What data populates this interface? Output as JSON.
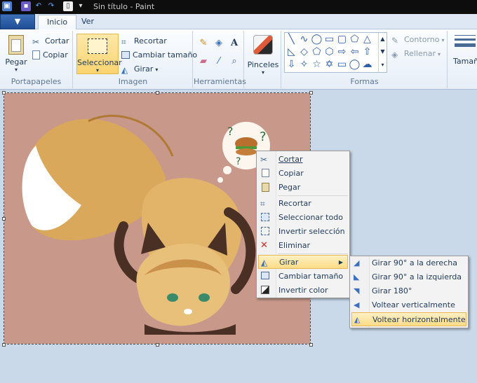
{
  "window": {
    "title": "Sin título - Paint"
  },
  "tabs": {
    "file": "▼",
    "inicio": "Inicio",
    "ver": "Ver"
  },
  "groups": {
    "portapapeles": {
      "label": "Portapapeles",
      "pegar": "Pegar",
      "cortar": "Cortar",
      "copiar": "Copiar"
    },
    "imagen": {
      "label": "Imagen",
      "seleccionar": "Seleccionar",
      "recortar": "Recortar",
      "cambiar_tamano": "Cambiar tamaño",
      "girar": "Girar"
    },
    "herramientas": {
      "label": "Herramientas"
    },
    "pinceles": {
      "label": "Pinceles"
    },
    "formas": {
      "label": "Formas",
      "contorno": "Contorno",
      "rellenar": "Rellenar",
      "tamano": "Tamaño"
    }
  },
  "context_menu": {
    "items": [
      {
        "label": "Cortar",
        "icon": "scissors-icon"
      },
      {
        "label": "Copiar",
        "icon": "copy-icon"
      },
      {
        "label": "Pegar",
        "icon": "paste-icon"
      },
      {
        "label": "Recortar",
        "icon": "crop-icon"
      },
      {
        "label": "Seleccionar todo",
        "icon": "select-all-icon"
      },
      {
        "label": "Invertir selección",
        "icon": "invert-selection-icon"
      },
      {
        "label": "Eliminar",
        "icon": "delete-icon"
      },
      {
        "label": "Girar",
        "icon": "rotate-icon",
        "highlighted": true,
        "submenu": true
      },
      {
        "label": "Cambiar tamaño",
        "icon": "resize-icon"
      },
      {
        "label": "Invertir color",
        "icon": "invert-color-icon"
      }
    ]
  },
  "submenu": {
    "items": [
      {
        "label": "Girar 90° a la derecha",
        "icon": "rotate-right-icon"
      },
      {
        "label": "Girar 90° a la izquierda",
        "icon": "rotate-left-icon"
      },
      {
        "label": "Girar 180°",
        "icon": "rotate-180-icon"
      },
      {
        "label": "Voltear verticalmente",
        "icon": "flip-vertical-icon"
      },
      {
        "label": "Voltear horizontalmente",
        "icon": "flip-horizontal-icon",
        "highlighted": true
      }
    ]
  },
  "colors": {
    "accent": "#fbd471",
    "canvas_bg": "#c8988a",
    "workspace": "#c9d9ea",
    "title_bar": "#0d0d0d"
  }
}
